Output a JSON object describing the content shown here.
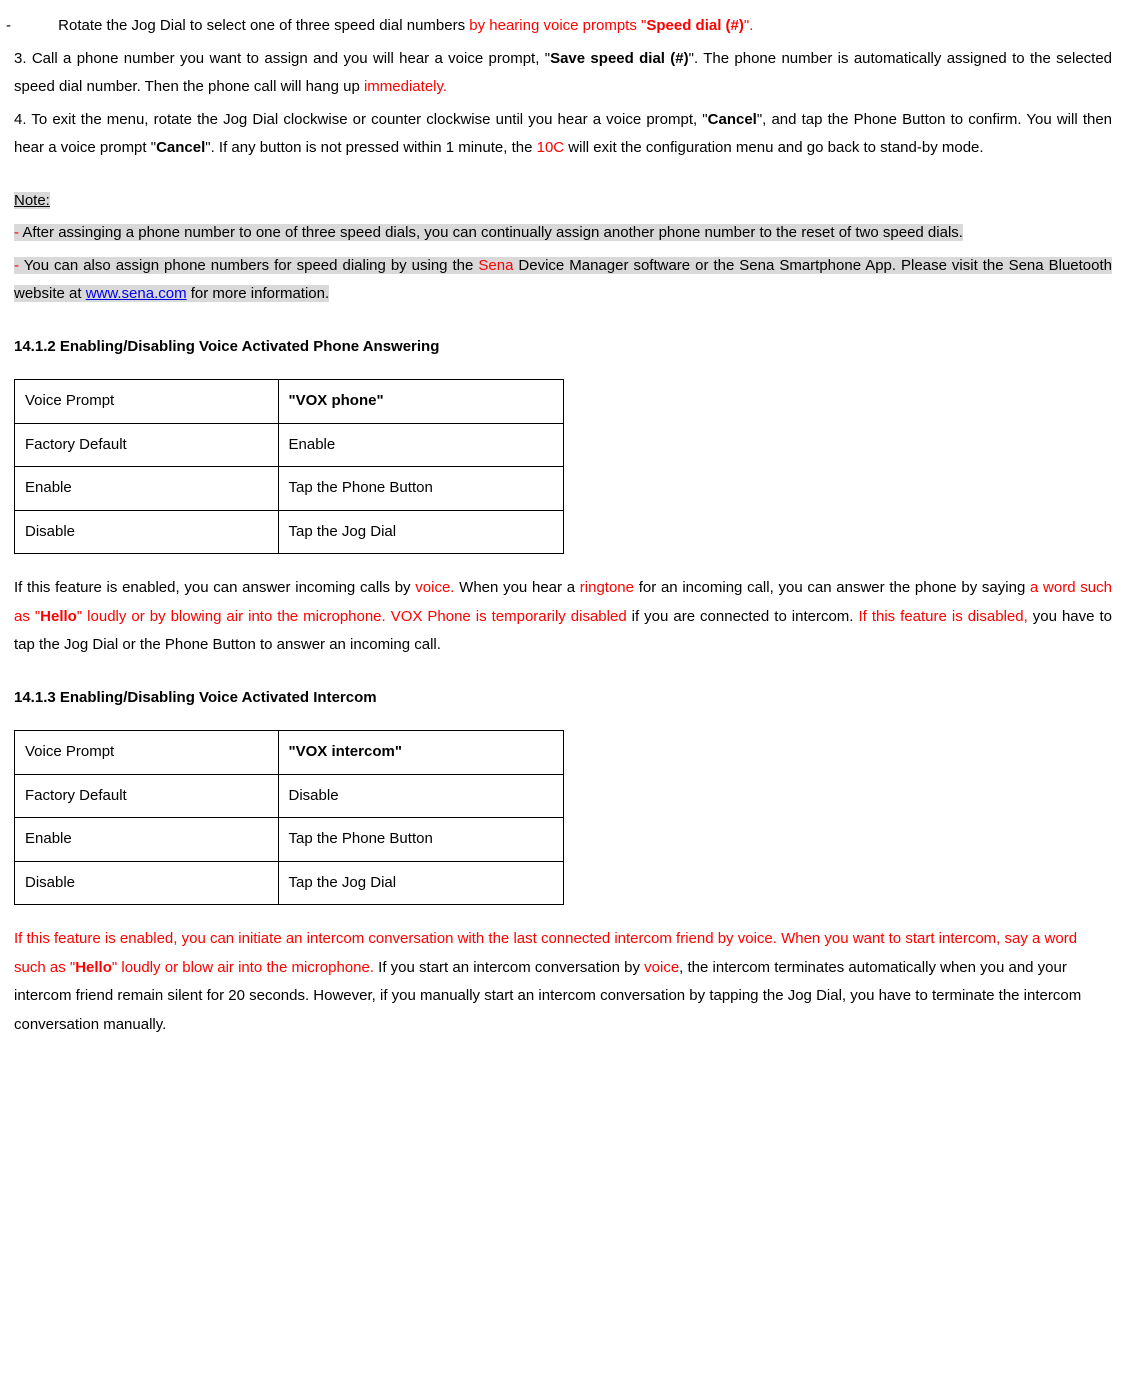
{
  "bullet": {
    "dash": "-",
    "t1": "Rotate the Jog Dial to select one of three speed dial numbers",
    "t2_red": " by hearing voice prompts \"",
    "t2_redbold": "Speed dial (#)",
    "t2_red_end": "\"."
  },
  "p3": {
    "a": "3. Call a phone number you want to assign and you will hear a voice prompt, \"",
    "b": "Save speed dial (#)",
    "c": "\". The phone number is automatically assigned to the selected speed dial number. Then the phone call will hang up ",
    "d": "immediately."
  },
  "p4": {
    "a": "4. To exit the menu, rotate the Jog Dial clockwise or counter clockwise until you hear a voice prompt, \"",
    "b": "Cancel",
    "c": "\", and tap the Phone Button to confirm. You will then hear a voice prompt \"",
    "d": "Cancel",
    "e": "\". If any button is not pressed within 1 minute, the ",
    "f": "10C",
    "g": " will exit the configuration menu and go back to stand-by mode."
  },
  "note": {
    "title": "Note:",
    "n1a": "- ",
    "n1b": "After assinging a phone number to one of three speed dials, you can continually assign another phone number to the reset of two speed dials.",
    "n2a": "- ",
    "n2b": "You can also assign phone numbers for speed dialing by using the ",
    "n2c": "Sena",
    "n2d": " Device Manager software or the Sena Smartphone App. Please visit the Sena Bluetooth website at ",
    "n2link": "www.sena.com",
    "n2e": " for more information."
  },
  "s1412": {
    "heading": "14.1.2 Enabling/Disabling Voice Activated Phone Answering",
    "table": {
      "r1c1": "Voice Prompt",
      "r1c2": "\"VOX phone\"",
      "r2c1": "Factory Default",
      "r2c2": "Enable",
      "r3c1": "Enable",
      "r3c2": "Tap the Phone Button",
      "r4c1": "Disable",
      "r4c2": "Tap the Jog Dial"
    },
    "p": {
      "a": "If this feature is enabled, you can answer incoming calls by ",
      "b": "voice.",
      "c": " When you hear a ",
      "d": "ringtone",
      "e": " for an incoming call, you can answer the phone by saying ",
      "f": "a word such as \"",
      "g": "Hello",
      "h": "\" loudly or by blowing air into the microphone. VOX Phone is temporarily disabled",
      "i": " if you are connected to intercom. ",
      "j": "If this feature is disabled,",
      "k": " you have to tap the Jog Dial or the Phone Button to answer an incoming call."
    }
  },
  "s1413": {
    "heading": "14.1.3 Enabling/Disabling Voice Activated Intercom",
    "table": {
      "r1c1": "Voice Prompt",
      "r1c2": "\"VOX intercom\"",
      "r2c1": "Factory Default",
      "r2c2": "Disable",
      "r3c1": "Enable",
      "r3c2": "Tap the Phone Button",
      "r4c1": "Disable",
      "r4c2": "Tap the Jog Dial"
    },
    "p": {
      "a": "If this feature is enabled, you can initiate an intercom conversation with the last connected intercom friend by voice. When you want to start intercom, say a word such as \"",
      "b": "Hello",
      "c": "\" loudly or blow air into the microphone.",
      "d": " If you start an intercom conversation by ",
      "e": "voice",
      "f": ", the intercom terminates automatically when you and your intercom friend remain silent for 20 seconds. However, if you manually start an intercom conversation by tapping the Jog Dial, you have to terminate the intercom conversation manually."
    }
  }
}
